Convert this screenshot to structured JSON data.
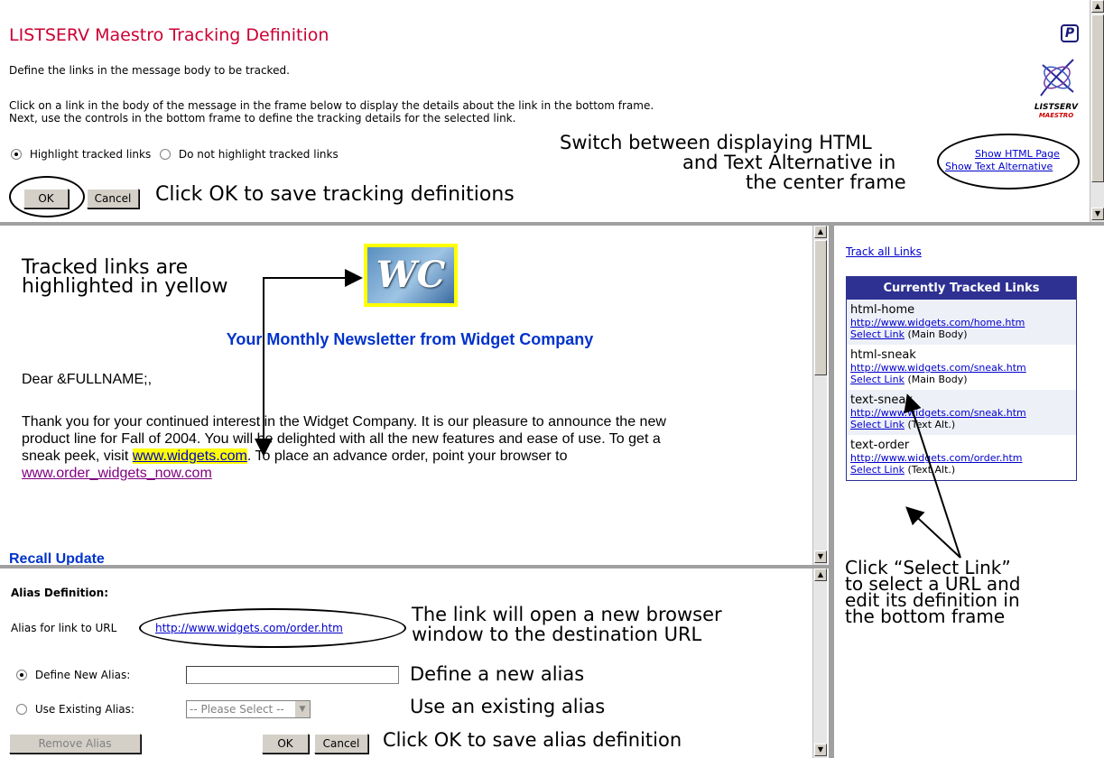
{
  "top": {
    "title": "LISTSERV Maestro Tracking Definition",
    "help_icon": "P",
    "logo_line1": "LISTSERV",
    "logo_line2": "MAESTRO",
    "intro": "Define the links in the message body to be tracked.",
    "instr1": "Click on a link in the body of the message in the frame below to display the details about the link in the bottom frame.",
    "instr2": "Next, use the controls in the bottom frame to define the tracking details for the selected link.",
    "radio_highlight": "Highlight tracked links",
    "radio_no_highlight": "Do not highlight tracked links",
    "show_html": "Show HTML Page",
    "show_text": "Show Text Alternative",
    "ok": "OK",
    "cancel": "Cancel"
  },
  "callouts": {
    "switch1": "Switch between displaying HTML",
    "switch2": "and Text Alternative in",
    "switch3": "the center frame",
    "click_ok": "Click OK to save tracking definitions",
    "tracked1": "Tracked links are",
    "tracked2": "highlighted in yellow",
    "select1": "Click “Select Link”",
    "select2": "to select a URL and",
    "select3": "edit its definition in",
    "select4": "the bottom frame",
    "newwin1": "The link will open a new browser",
    "newwin2": "window to the destination URL",
    "define_new": "Define a new alias",
    "use_existing": "Use an existing alias",
    "click_ok_alias": "Click OK to save alias definition"
  },
  "message": {
    "logo": "WC",
    "headline": "Your Monthly Newsletter from Widget Company",
    "greeting": "Dear &FULLNAME;,",
    "body1": "Thank you for your continued interest in the Widget Company. It is our pleasure to announce the new",
    "body2": "product line for Fall of 2004. You will be delighted with all the new features and ease of use. To get a",
    "body3_pre": "sneak peek, visit ",
    "body3_link": "www.widgets.com",
    "body3_post": ". To place an advance order, point your browser to",
    "body4_link": "www.order_widgets_now.com",
    "recall": "Recall Update"
  },
  "right": {
    "track_all": "Track all Links",
    "table_title": "Currently Tracked Links",
    "items": [
      {
        "name": "html-home",
        "url": "http://www.widgets.com/home.htm",
        "select": "Select Link",
        "where": " (Main Body)"
      },
      {
        "name": "html-sneak",
        "url": "http://www.widgets.com/sneak.htm",
        "select": "Select Link",
        "where": " (Main Body)"
      },
      {
        "name": "text-sneak",
        "url": "http://www.widgets.com/sneak.htm",
        "select": "Select Link",
        "where": " (Text Alt.)"
      },
      {
        "name": "text-order",
        "url": "http://www.widgets.com/order.htm",
        "select": "Select Link",
        "where": " (Text Alt.)"
      }
    ]
  },
  "alias": {
    "heading": "Alias Definition:",
    "for_link": "Alias for link to URL",
    "url": "http://www.widgets.com/order.htm",
    "define_label": "Define New Alias:",
    "define_value": "",
    "use_label": "Use Existing Alias:",
    "select_value": "-- Please Select --",
    "remove": "Remove Alias",
    "ok": "OK",
    "cancel": "Cancel"
  },
  "colors": {
    "title_red": "#cc0033",
    "headline_blue": "#0033cc",
    "table_header": "#2e3192",
    "highlight": "#ffff00"
  }
}
